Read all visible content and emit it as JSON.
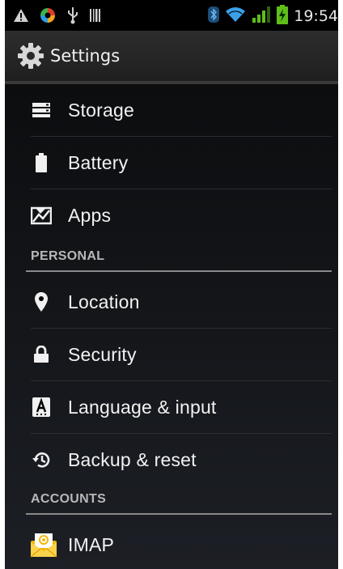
{
  "status_bar": {
    "time": "19:54",
    "left_icons": [
      "warning-icon",
      "app-logo-icon",
      "usb-icon",
      "barcode-icon"
    ],
    "right_icons": [
      "bluetooth-icon",
      "wifi-icon",
      "signal-icon",
      "battery-charging-icon"
    ]
  },
  "action_bar": {
    "title": "Settings",
    "icon": "settings-gear-icon"
  },
  "items_top": [
    {
      "label": "Storage",
      "icon": "storage-icon"
    },
    {
      "label": "Battery",
      "icon": "battery-icon"
    },
    {
      "label": "Apps",
      "icon": "apps-icon"
    }
  ],
  "section_personal": "PERSONAL",
  "items_personal": [
    {
      "label": "Location",
      "icon": "location-pin-icon"
    },
    {
      "label": "Security",
      "icon": "lock-icon"
    },
    {
      "label": "Language & input",
      "icon": "language-keyboard-icon"
    },
    {
      "label": "Backup & reset",
      "icon": "backup-restore-icon"
    }
  ],
  "section_accounts": "ACCOUNTS",
  "items_accounts": [
    {
      "label": "IMAP",
      "icon": "email-envelope-icon"
    }
  ],
  "colors": {
    "background": "#000000",
    "text": "#f2f2f2",
    "section_text": "#b8b8b8",
    "wifi_blue": "#3aa0e8",
    "signal_green": "#5fbf1a"
  }
}
